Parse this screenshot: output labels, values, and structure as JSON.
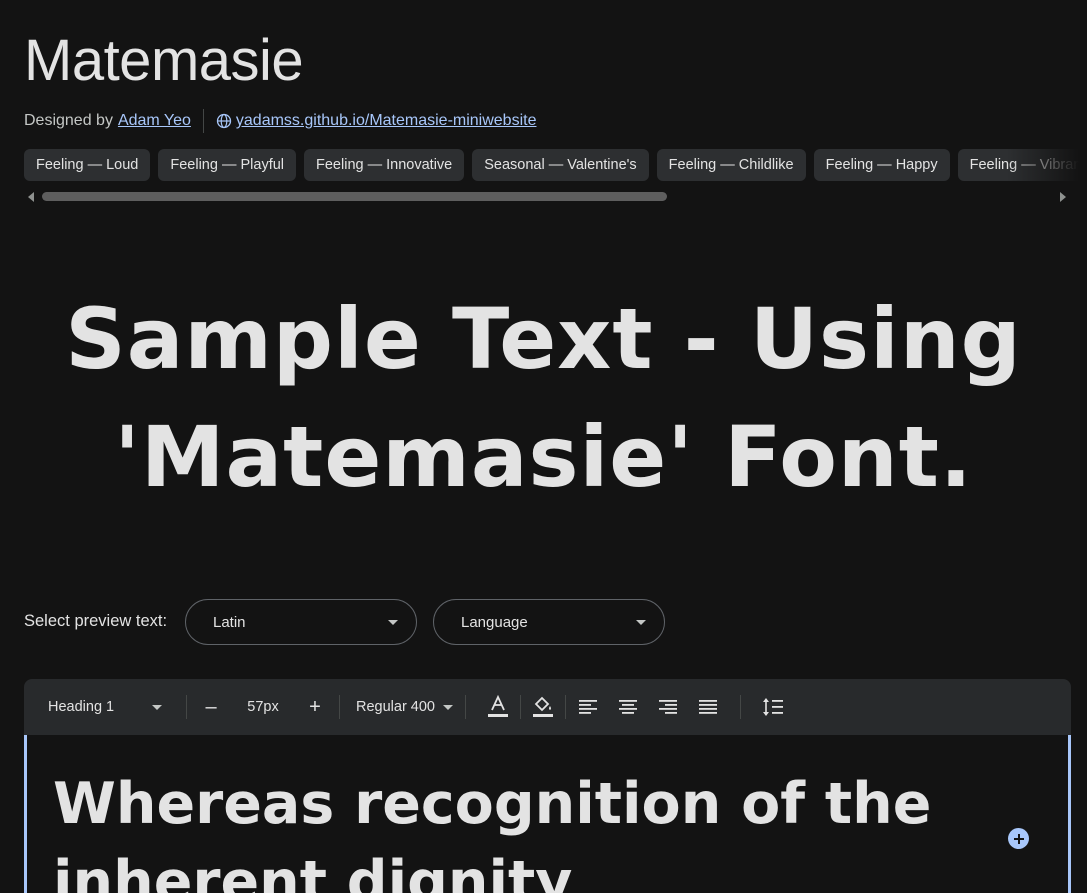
{
  "family": {
    "title": "Matemasie",
    "designed_by_label": "Designed by",
    "designer": "Adam Yeo",
    "website": "yadamss.github.io/Matemasie-miniwebsite"
  },
  "tags": [
    "Feeling — Loud",
    "Feeling — Playful",
    "Feeling — Innovative",
    "Seasonal — Valentine's",
    "Feeling — Childlike",
    "Feeling — Happy",
    "Feeling — Vibrant"
  ],
  "sample_text": "Sample Text - Using 'Matemasie' Font.",
  "preview": {
    "label": "Select preview text:",
    "script_value": "Latin",
    "language_placeholder": "Language"
  },
  "toolbar": {
    "style": "Heading 1",
    "minus": "–",
    "size": "57px",
    "plus": "+",
    "weight": "Regular 400"
  },
  "editor_text": "Whereas recognition of the inherent dignity",
  "colors": {
    "background": "#131313",
    "accent": "#a8c7fa",
    "chip": "#2d2f31"
  }
}
